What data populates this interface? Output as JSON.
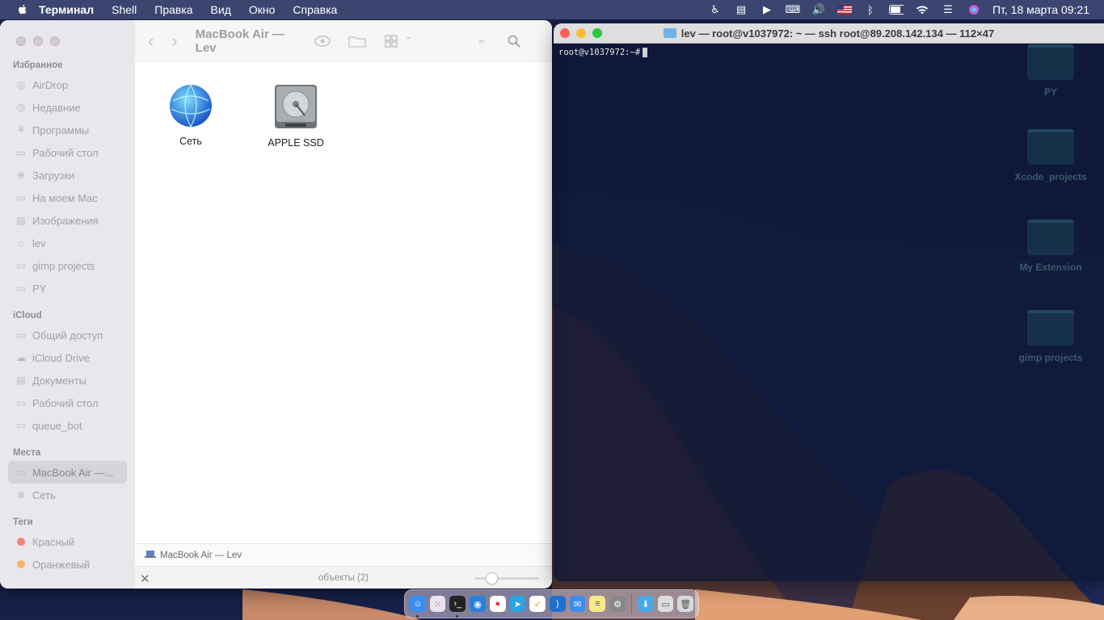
{
  "menubar": {
    "app_name": "Терминал",
    "items": [
      "Shell",
      "Правка",
      "Вид",
      "Окно",
      "Справка"
    ],
    "clock": "Пт, 18 марта  09:21"
  },
  "finder": {
    "title": "MacBook Air — Lev",
    "sidebar": {
      "favorites_header": "Избранное",
      "favorites": [
        {
          "label": "AirDrop",
          "icon": "airdrop-icon"
        },
        {
          "label": "Недавние",
          "icon": "clock-icon"
        },
        {
          "label": "Программы",
          "icon": "apps-icon"
        },
        {
          "label": "Рабочий стол",
          "icon": "desktop-icon"
        },
        {
          "label": "Загрузки",
          "icon": "download-icon"
        },
        {
          "label": "На моем Mac",
          "icon": "folder-icon"
        },
        {
          "label": "Изображения",
          "icon": "image-icon"
        },
        {
          "label": "lev",
          "icon": "home-icon"
        },
        {
          "label": "gimp projects",
          "icon": "folder-icon"
        },
        {
          "label": "PY",
          "icon": "folder-icon"
        }
      ],
      "icloud_header": "iCloud",
      "icloud": [
        {
          "label": "Общий доступ",
          "icon": "shared-folder-icon"
        },
        {
          "label": "iCloud Drive",
          "icon": "cloud-icon"
        },
        {
          "label": "Документы",
          "icon": "document-icon"
        },
        {
          "label": "Рабочий стол",
          "icon": "desktop-icon"
        },
        {
          "label": "queue_bot",
          "icon": "folder-icon"
        }
      ],
      "places_header": "Места",
      "places": [
        {
          "label": "MacBook Air —...",
          "icon": "laptop-icon"
        },
        {
          "label": "Сеть",
          "icon": "network-icon"
        }
      ],
      "tags_header": "Теги",
      "tags": [
        {
          "label": "Красный",
          "color": "#f2837b"
        },
        {
          "label": "Оранжевый",
          "color": "#f7b267"
        }
      ]
    },
    "files": [
      {
        "label": "Сеть",
        "icon": "network-globe-icon"
      },
      {
        "label": "APPLE SSD",
        "icon": "hard-drive-icon"
      }
    ],
    "pathbar": "MacBook Air — Lev",
    "status": "объекты (2)"
  },
  "terminal": {
    "title": "lev — root@v1037972: ~ — ssh root@89.208.142.134 — 112×47",
    "prompt": "root@v1037972:~#"
  },
  "desktop_icons": [
    {
      "label": "PY"
    },
    {
      "label": "Xcode_projects"
    },
    {
      "label": "My Extension"
    },
    {
      "label": "gimp projects"
    }
  ],
  "colors": {
    "accent_red": "#ff5f57",
    "accent_yellow": "#febc2e",
    "accent_green": "#28c840"
  }
}
